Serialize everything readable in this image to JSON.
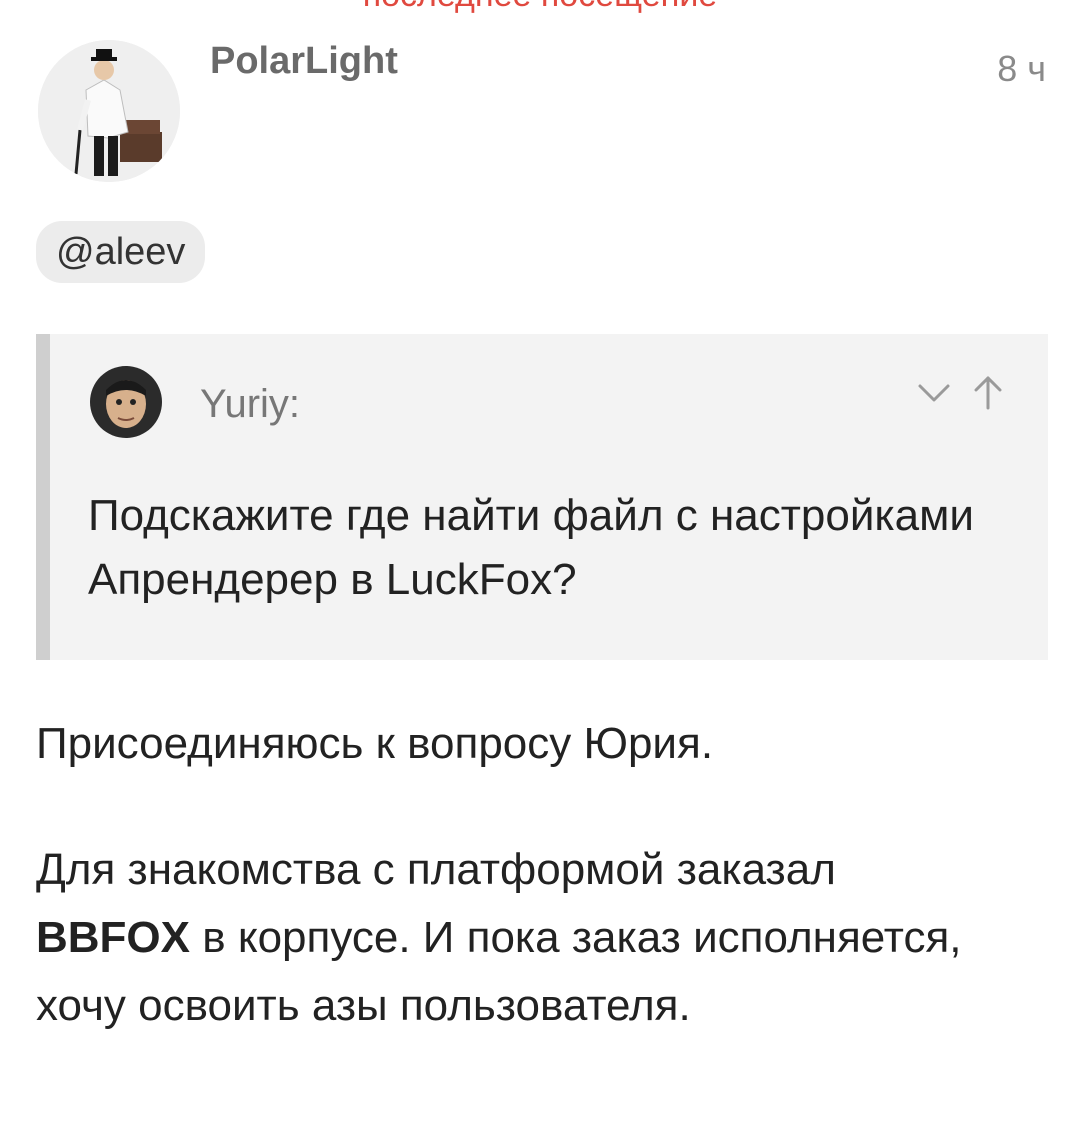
{
  "header_cut": {
    "text": "последнее посещение",
    "color": "#e0493f"
  },
  "post": {
    "author": "PolarLight",
    "time": "8 ч",
    "mention": "@aleev",
    "quote": {
      "author": "Yuriy:",
      "text": "Подскажите где найти файл с настройками Апрендерер в LuckFox?",
      "actions": [
        "chevron-down-icon",
        "arrow-up-icon"
      ]
    },
    "paragraph1": "Присоединяюсь к вопросу Юрия.",
    "paragraph2": {
      "before": "Для знакомства с платформой заказал",
      "bold": "BBFOX",
      "after": "в корпусе. И пока заказ исполняется, хочу освоить азы пользователя."
    }
  }
}
